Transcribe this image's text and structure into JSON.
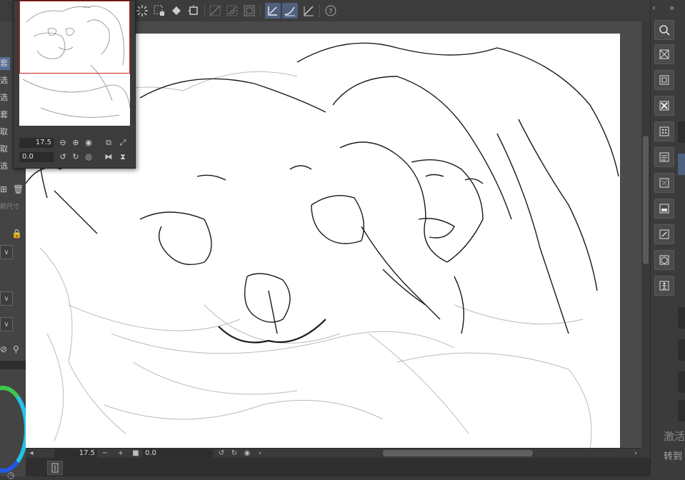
{
  "toolbar": {
    "buttons": [
      {
        "name": "marquee-spin-icon",
        "glyph": "✺"
      },
      {
        "name": "selection-clear-icon",
        "glyph": "⬚"
      },
      {
        "name": "fill-bucket-icon",
        "glyph": "◆"
      },
      {
        "name": "transform-icon",
        "glyph": "⌗"
      },
      {
        "name": "ruler-snap-off-icon",
        "glyph": "▧"
      },
      {
        "name": "special-ruler-icon",
        "glyph": "▨"
      },
      {
        "name": "grid-snap-icon",
        "glyph": "▣"
      },
      {
        "name": "vector-stroke-icon",
        "glyph": "⟋"
      },
      {
        "name": "brush-stroke-icon",
        "glyph": "✎"
      },
      {
        "name": "pen-pressure-icon",
        "glyph": "⌳"
      },
      {
        "name": "help-icon",
        "glyph": "?"
      }
    ]
  },
  "left_panel": {
    "menu_labels": [
      "套",
      "选",
      "选",
      "套",
      "取",
      "取",
      "选"
    ],
    "dim_text": "刷尺寸"
  },
  "navigator": {
    "zoom_value": "17.5",
    "rotate_value": "0.0"
  },
  "status_bar": {
    "zoom_value": "17.5",
    "rotate_value": "0.0"
  },
  "right_panel": {
    "watermark_line1": "激活",
    "watermark_line2": "转到"
  }
}
